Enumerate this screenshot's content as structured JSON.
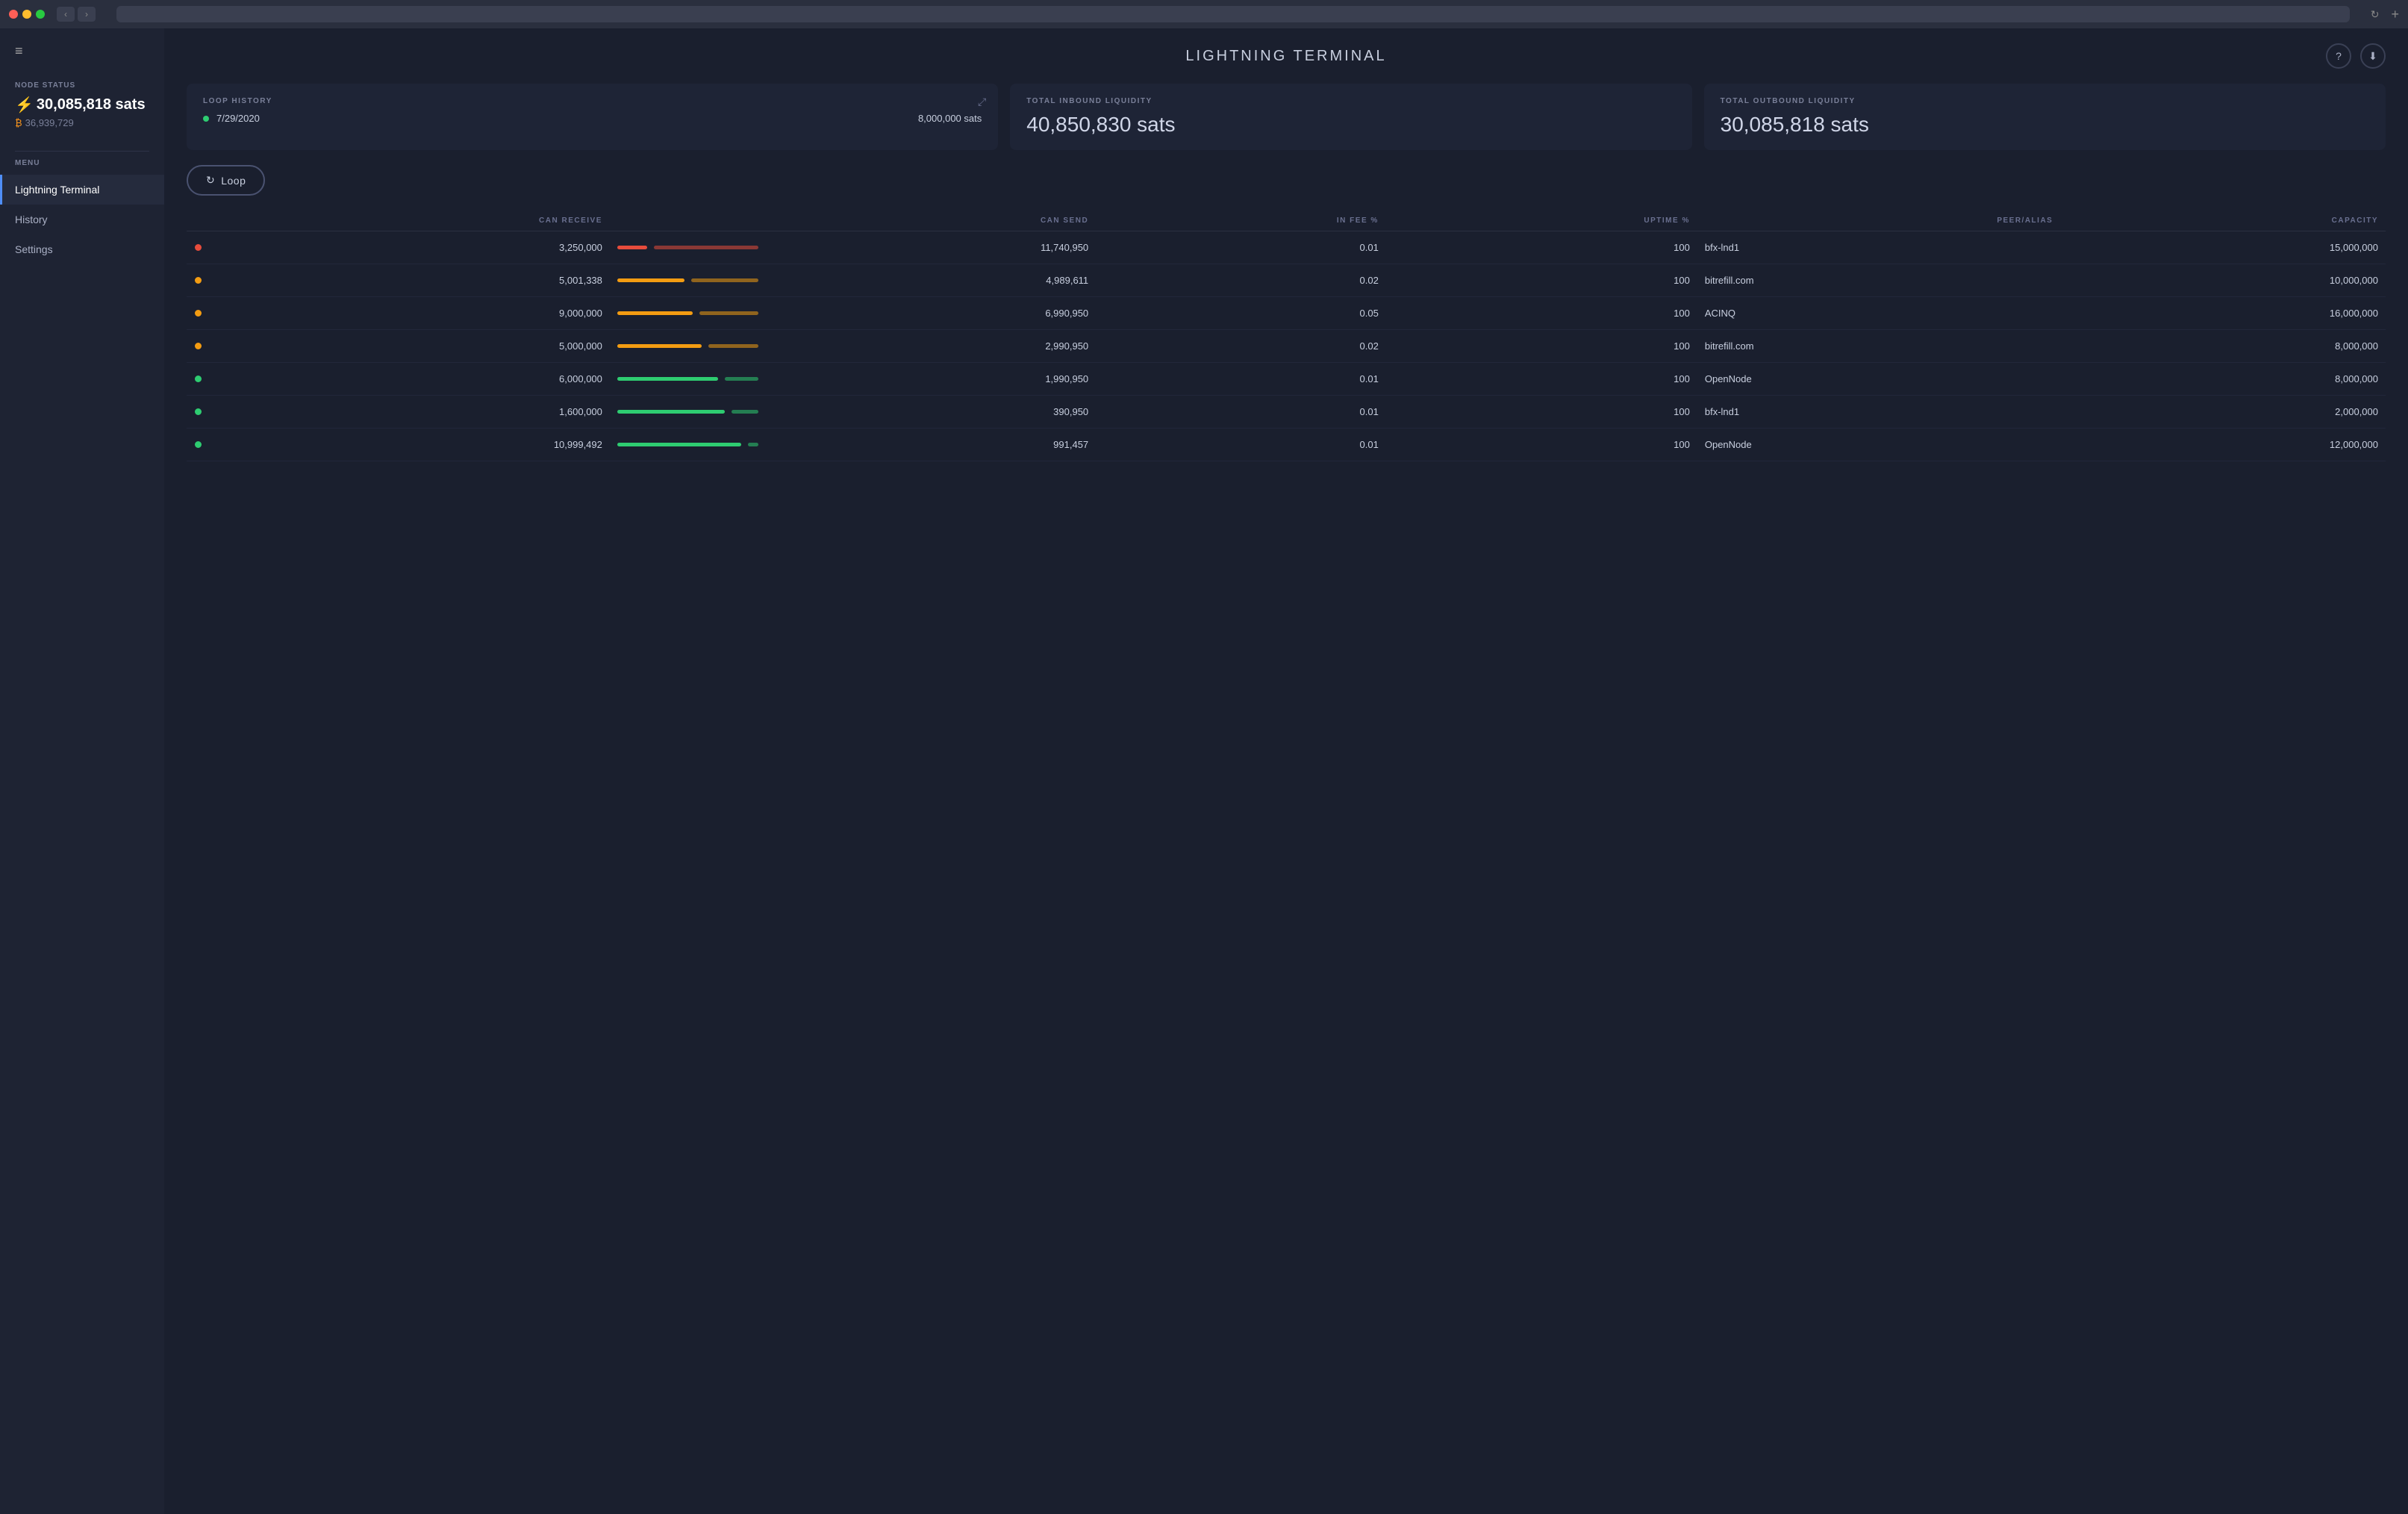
{
  "titlebar": {
    "back_btn": "‹",
    "forward_btn": "›",
    "reload_icon": "↻",
    "new_tab": "+"
  },
  "sidebar": {
    "hamburger": "≡",
    "node_status_label": "NODE STATUS",
    "balance_lightning_icon": "⚡",
    "balance_lightning": "30,085,818 sats",
    "balance_bitcoin_icon": "₿",
    "balance_bitcoin": "36,939,729",
    "menu_label": "MENU",
    "items": [
      {
        "id": "lightning-terminal",
        "label": "Lightning Terminal",
        "active": true
      },
      {
        "id": "history",
        "label": "History",
        "active": false
      },
      {
        "id": "settings",
        "label": "Settings",
        "active": false
      }
    ]
  },
  "header": {
    "title": "LIGHTNING TERMINAL",
    "help_icon": "?",
    "download_icon": "⬇"
  },
  "stats": {
    "loop_history": {
      "label": "LOOP HISTORY",
      "date": "7/29/2020",
      "amount": "8,000,000 sats",
      "dot_color": "#2ecc71"
    },
    "inbound": {
      "label": "TOTAL INBOUND LIQUIDITY",
      "value": "40,850,830 sats"
    },
    "outbound": {
      "label": "TOTAL OUTBOUND LIQUIDITY",
      "value": "30,085,818 sats"
    }
  },
  "loop_button": {
    "label": "Loop",
    "icon": "↻"
  },
  "table": {
    "headers": [
      {
        "id": "status",
        "label": ""
      },
      {
        "id": "can-receive",
        "label": "CAN RECEIVE"
      },
      {
        "id": "bar",
        "label": ""
      },
      {
        "id": "can-send",
        "label": "CAN SEND"
      },
      {
        "id": "in-fee",
        "label": "IN FEE %"
      },
      {
        "id": "uptime",
        "label": "UPTIME %"
      },
      {
        "id": "peer",
        "label": "PEER/ALIAS"
      },
      {
        "id": "capacity",
        "label": "CAPACITY"
      }
    ],
    "rows": [
      {
        "status_color": "#e74c3c",
        "can_receive": "3,250,000",
        "can_send": "11,740,950",
        "in_fee": "0.01",
        "uptime": "100",
        "peer": "bfx-lnd1",
        "capacity": "15,000,000",
        "bar_left_color": "#e74c3c",
        "bar_right_color": "#e74c3c",
        "bar_left_pct": 22,
        "bar_right_pct": 78
      },
      {
        "status_color": "#f39c12",
        "can_receive": "5,001,338",
        "can_send": "4,989,611",
        "in_fee": "0.02",
        "uptime": "100",
        "peer": "bitrefill.com",
        "capacity": "10,000,000",
        "bar_left_color": "#f39c12",
        "bar_right_color": "#f39c12",
        "bar_left_pct": 50,
        "bar_right_pct": 50
      },
      {
        "status_color": "#f39c12",
        "can_receive": "9,000,000",
        "can_send": "6,990,950",
        "in_fee": "0.05",
        "uptime": "100",
        "peer": "ACINQ",
        "capacity": "16,000,000",
        "bar_left_color": "#f39c12",
        "bar_right_color": "#f39c12",
        "bar_left_pct": 56,
        "bar_right_pct": 44
      },
      {
        "status_color": "#f39c12",
        "can_receive": "5,000,000",
        "can_send": "2,990,950",
        "in_fee": "0.02",
        "uptime": "100",
        "peer": "bitrefill.com",
        "capacity": "8,000,000",
        "bar_left_color": "#f39c12",
        "bar_right_color": "#f39c12",
        "bar_left_pct": 63,
        "bar_right_pct": 37
      },
      {
        "status_color": "#2ecc71",
        "can_receive": "6,000,000",
        "can_send": "1,990,950",
        "in_fee": "0.01",
        "uptime": "100",
        "peer": "OpenNode",
        "capacity": "8,000,000",
        "bar_left_color": "#2ecc71",
        "bar_right_color": "#2ecc71",
        "bar_left_pct": 75,
        "bar_right_pct": 25
      },
      {
        "status_color": "#2ecc71",
        "can_receive": "1,600,000",
        "can_send": "390,950",
        "in_fee": "0.01",
        "uptime": "100",
        "peer": "bfx-lnd1",
        "capacity": "2,000,000",
        "bar_left_color": "#2ecc71",
        "bar_right_color": "#2ecc71",
        "bar_left_pct": 80,
        "bar_right_pct": 20
      },
      {
        "status_color": "#2ecc71",
        "can_receive": "10,999,492",
        "can_send": "991,457",
        "in_fee": "0.01",
        "uptime": "100",
        "peer": "OpenNode",
        "capacity": "12,000,000",
        "bar_left_color": "#2ecc71",
        "bar_right_color": "#2ecc71",
        "bar_left_pct": 92,
        "bar_right_pct": 8
      }
    ]
  },
  "colors": {
    "bg_main": "#1a1f2e",
    "bg_sidebar": "#1e2333",
    "bg_card": "#1e2436",
    "accent_blue": "#4f8ef7",
    "text_muted": "#7a8099",
    "text_primary": "#c8cfdf"
  }
}
